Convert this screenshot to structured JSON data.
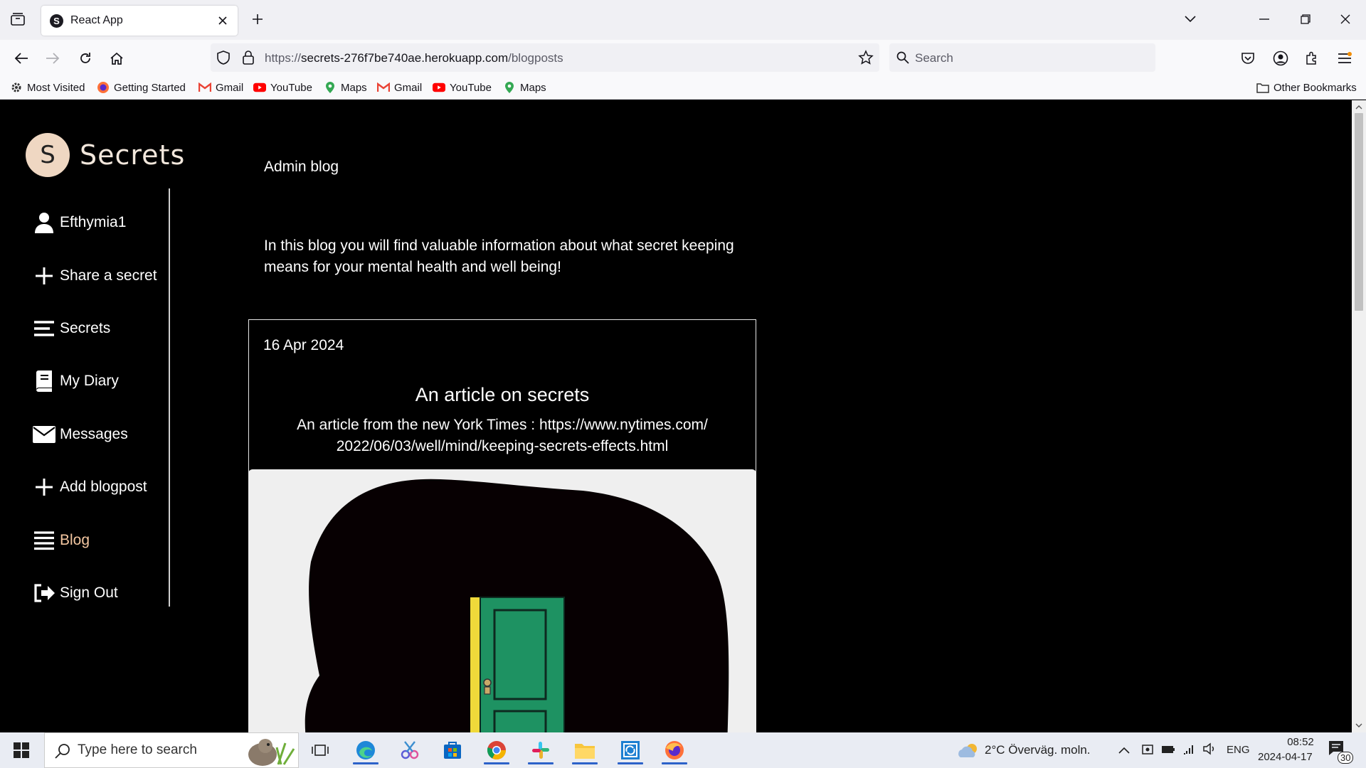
{
  "browser": {
    "tab_title": "React App",
    "tab_favicon_letter": "S",
    "url_prefix": "https://",
    "url_domain": "secrets-276f7be740ae.herokuapp.com",
    "url_path": "/blogposts",
    "search_placeholder": "Search",
    "bookmarks": [
      "Most Visited",
      "Getting Started",
      "Gmail",
      "YouTube",
      "Maps",
      "Gmail",
      "YouTube",
      "Maps"
    ],
    "other_bookmarks": "Other Bookmarks"
  },
  "app": {
    "logo_letter": "S",
    "logo_text": "Secrets",
    "menu": [
      {
        "label": "Efthymia1",
        "icon": "user-icon"
      },
      {
        "label": "Share a secret",
        "icon": "plus-icon"
      },
      {
        "label": "Secrets",
        "icon": "list-icon"
      },
      {
        "label": "My Diary",
        "icon": "book-icon"
      },
      {
        "label": "Messages",
        "icon": "envelope-icon"
      },
      {
        "label": "Add blogpost",
        "icon": "plus-icon"
      },
      {
        "label": "Blog",
        "icon": "list-icon",
        "active": true
      },
      {
        "label": "Sign Out",
        "icon": "sign-out-icon"
      }
    ],
    "active_color": "#f3c6a0",
    "heading": "Admin blog",
    "intro": "In this blog you will find valuable information about what secret keeping means for your mental health and well being!",
    "post": {
      "date": "16 Apr 2024",
      "title": "An article on secrets",
      "body": "An article from the new York Times :  https://www.nytimes.com/ 2022/06/03/well/mind/keeping-secrets-effects.html"
    }
  },
  "taskbar": {
    "search_placeholder": "Type here to search",
    "weather": "2°C  Överväg. moln.",
    "language": "ENG",
    "time": "08:52",
    "date": "2024-04-17",
    "notifications": "30"
  }
}
